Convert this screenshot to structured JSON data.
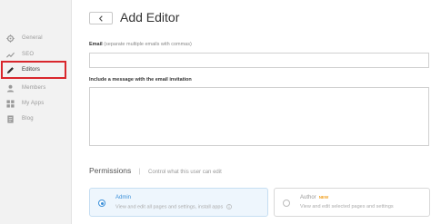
{
  "sidebar": {
    "items": [
      {
        "label": "General",
        "icon": "gear-icon"
      },
      {
        "label": "SEO",
        "icon": "trend-icon"
      },
      {
        "label": "Editors",
        "icon": "pencil-icon",
        "active": true
      },
      {
        "label": "Members",
        "icon": "person-icon"
      },
      {
        "label": "My Apps",
        "icon": "grid-icon"
      },
      {
        "label": "Blog",
        "icon": "document-icon"
      }
    ],
    "highlight_color": "#d9262c"
  },
  "header": {
    "title": "Add Editor",
    "back_icon": "chevron-left-icon"
  },
  "form": {
    "email_label": "Email",
    "email_hint": "(separate multiple emails with commas)",
    "email_value": "",
    "message_label": "Include a message with the email invitation",
    "message_value": ""
  },
  "permissions": {
    "title": "Permissions",
    "separator": "|",
    "hint": "Control what this user can edit",
    "roles": [
      {
        "name": "Admin",
        "badge": "",
        "description": "View and edit all pages and settings, install apps",
        "selected": true
      },
      {
        "name": "Author",
        "badge": "NEW",
        "description": "View and edit selected pages and settings",
        "selected": false
      }
    ]
  },
  "colors": {
    "accent": "#3a8fd9",
    "sidebar_bg": "#f2f2f2",
    "selected_card_bg": "#eef6fd"
  }
}
